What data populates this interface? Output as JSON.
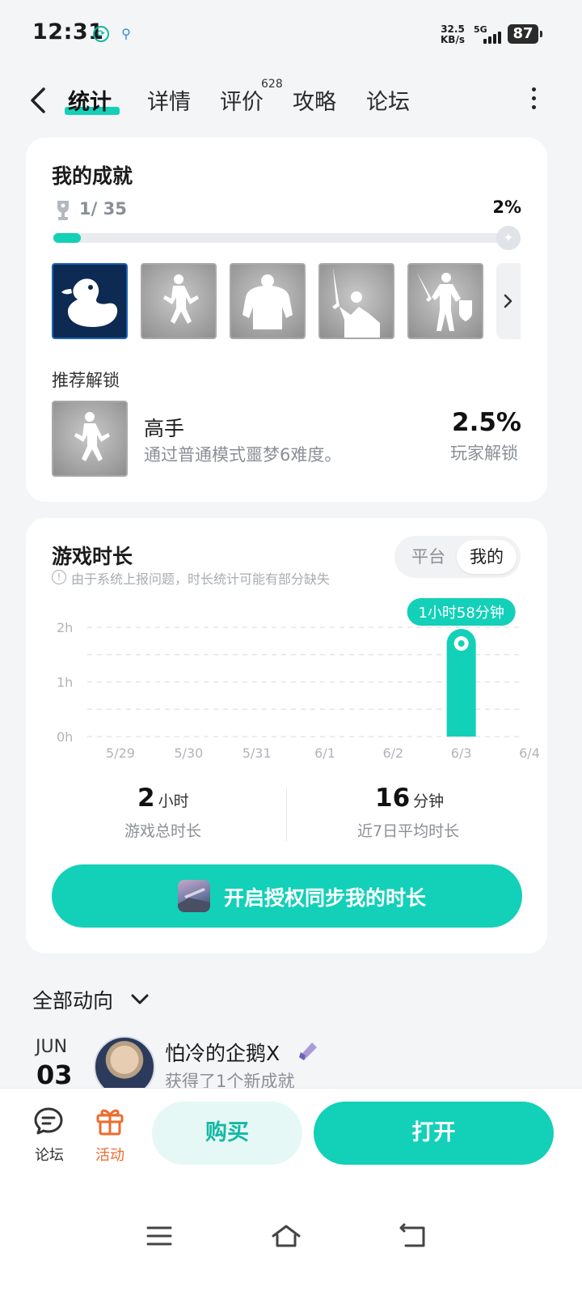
{
  "status_bar": {
    "time": "12:31",
    "net_speed": "32.5",
    "net_unit": "KB/s",
    "network": "5G",
    "battery": "87",
    "notif_icons": [
      "tap-icon",
      "leaf-icon"
    ]
  },
  "nav": {
    "tabs": [
      {
        "label": "统计",
        "active": true
      },
      {
        "label": "详情",
        "active": false
      },
      {
        "label": "评价",
        "active": false,
        "badge": "628"
      },
      {
        "label": "攻略",
        "active": false
      },
      {
        "label": "论坛",
        "active": false
      }
    ]
  },
  "achievements": {
    "title": "我的成就",
    "count": "1/ 35",
    "percent": "2%",
    "progress": 0.02,
    "badges": [
      {
        "name": "duck",
        "unlocked": true
      },
      {
        "name": "dancer",
        "unlocked": false
      },
      {
        "name": "strongman",
        "unlocked": false
      },
      {
        "name": "swordsman",
        "unlocked": false
      },
      {
        "name": "knight",
        "unlocked": false
      }
    ],
    "recommend_title": "推荐解锁",
    "recommend": {
      "name": "高手",
      "desc": "通过普通模式噩梦6难度。",
      "percent": "2.5%",
      "percent_label": "玩家解锁"
    }
  },
  "playtime": {
    "title": "游戏时长",
    "note": "由于系统上报问题，时长统计可能有部分缺失",
    "segment": {
      "options": [
        "平台",
        "我的"
      ],
      "selected": "我的"
    },
    "total_value": "2",
    "total_unit": "小时",
    "total_label": "游戏总时长",
    "avg_value": "16",
    "avg_unit": "分钟",
    "avg_label": "近7日平均时长",
    "sync_button": "开启授权同步我的时长"
  },
  "chart_data": {
    "type": "bar",
    "categories": [
      "5/29",
      "5/30",
      "5/31",
      "6/1",
      "6/2",
      "6/3",
      "6/4"
    ],
    "values": [
      0,
      0,
      0,
      0,
      0,
      1.97,
      0
    ],
    "y_ticks": [
      "0h",
      "1h",
      "2h"
    ],
    "ylim": [
      0,
      2
    ],
    "tooltip": "1小时58分钟",
    "tooltip_index": 5,
    "bar_color": "#13d0b8",
    "grid": true
  },
  "feed": {
    "title": "全部动向",
    "month": "JUN",
    "day": "03",
    "user": "怕冷的企鹅X",
    "action": "获得了1个新成就"
  },
  "bottom": {
    "forum_label": "论坛",
    "activity_label": "活动",
    "buy": "购买",
    "open": "打开"
  },
  "colors": {
    "accent": "#13d0b8",
    "orange": "#f06a2d",
    "muted": "#8a8f96"
  }
}
